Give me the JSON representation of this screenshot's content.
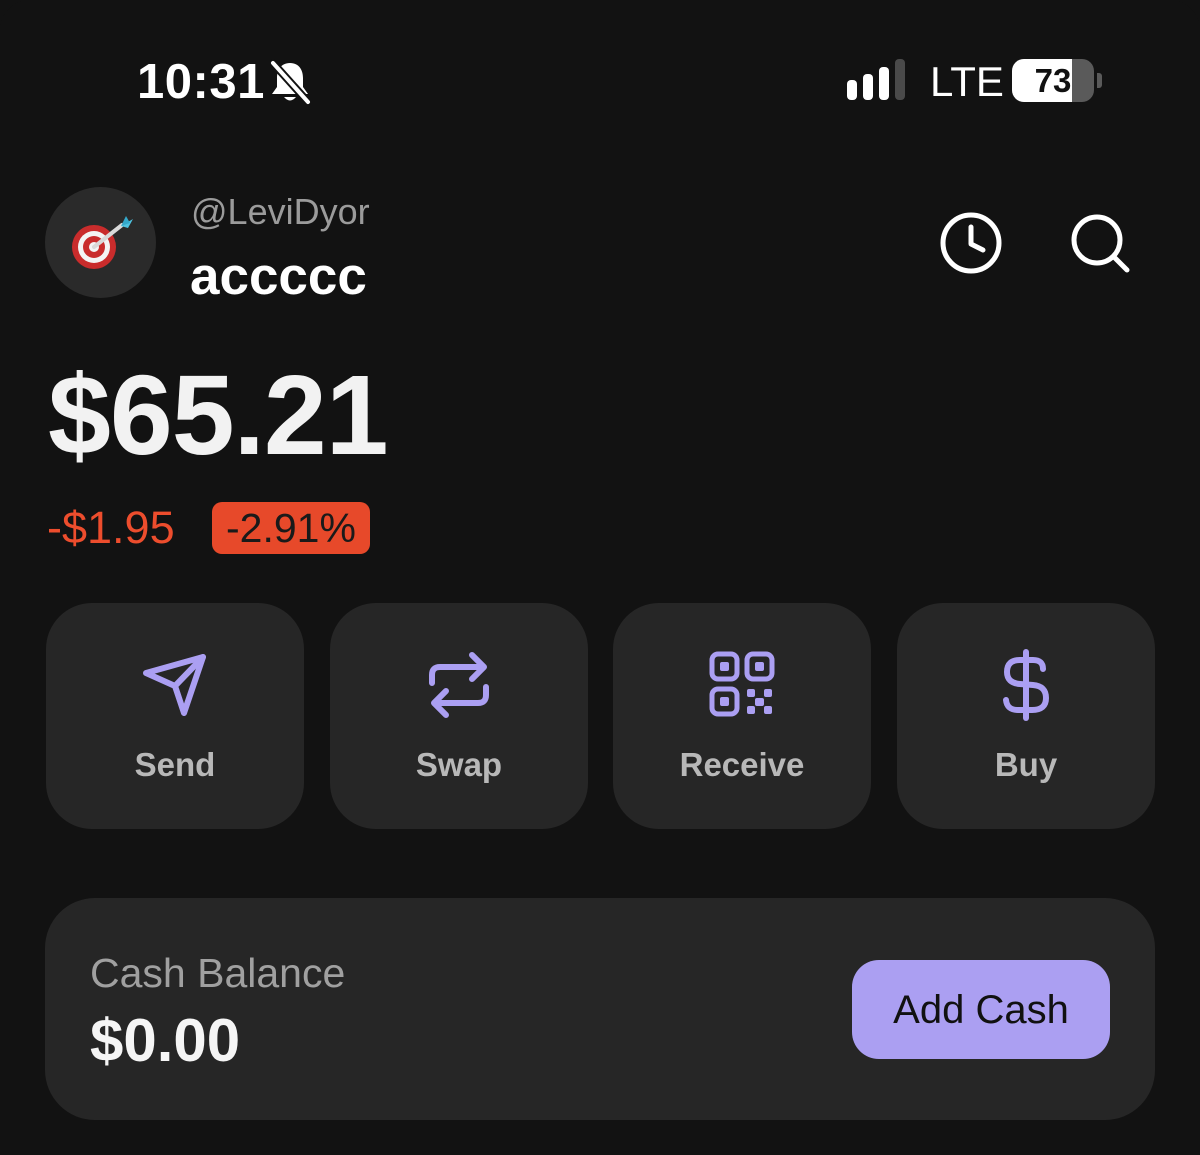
{
  "status_bar": {
    "time": "10:31",
    "network": "LTE",
    "battery_level": "73",
    "battery_fraction": 0.73,
    "signal_bars_active": 3,
    "signal_bars_total": 4,
    "icons": [
      "bell-slash-icon",
      "signal-icon"
    ]
  },
  "profile": {
    "handle": "@LeviDyor",
    "account_name": "accccc",
    "avatar_icon": "dart-target-icon",
    "header_icons": [
      "history-clock-icon",
      "search-icon"
    ]
  },
  "balance": {
    "total": "$65.21",
    "change_amount": "-$1.95",
    "change_percent": "-2.91%"
  },
  "actions": [
    {
      "label": "Send",
      "icon": "send-icon"
    },
    {
      "label": "Swap",
      "icon": "swap-icon"
    },
    {
      "label": "Receive",
      "icon": "qr-code-icon"
    },
    {
      "label": "Buy",
      "icon": "dollar-icon"
    }
  ],
  "cash": {
    "label": "Cash Balance",
    "amount": "$0.00",
    "button_label": "Add Cash"
  },
  "colors": {
    "background": "#121212",
    "card": "#262626",
    "accent": "#ab9ff2",
    "negative": "#ed4d2d",
    "negative_badge": "#e7492a",
    "muted_text": "#9b9b9b"
  }
}
